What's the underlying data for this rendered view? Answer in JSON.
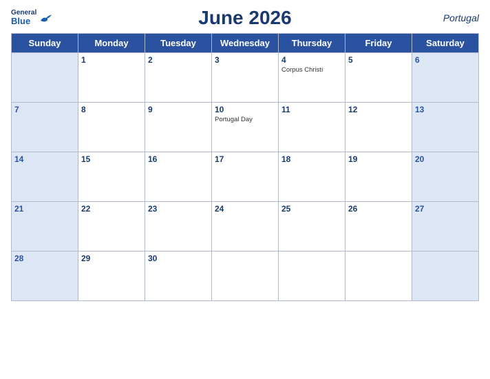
{
  "header": {
    "logo_general": "General",
    "logo_blue": "Blue",
    "title": "June 2026",
    "country": "Portugal"
  },
  "weekdays": [
    "Sunday",
    "Monday",
    "Tuesday",
    "Wednesday",
    "Thursday",
    "Friday",
    "Saturday"
  ],
  "weeks": [
    [
      {
        "day": "",
        "holiday": ""
      },
      {
        "day": "1",
        "holiday": ""
      },
      {
        "day": "2",
        "holiday": ""
      },
      {
        "day": "3",
        "holiday": ""
      },
      {
        "day": "4",
        "holiday": "Corpus Christi"
      },
      {
        "day": "5",
        "holiday": ""
      },
      {
        "day": "6",
        "holiday": ""
      }
    ],
    [
      {
        "day": "7",
        "holiday": ""
      },
      {
        "day": "8",
        "holiday": ""
      },
      {
        "day": "9",
        "holiday": ""
      },
      {
        "day": "10",
        "holiday": "Portugal Day"
      },
      {
        "day": "11",
        "holiday": ""
      },
      {
        "day": "12",
        "holiday": ""
      },
      {
        "day": "13",
        "holiday": ""
      }
    ],
    [
      {
        "day": "14",
        "holiday": ""
      },
      {
        "day": "15",
        "holiday": ""
      },
      {
        "day": "16",
        "holiday": ""
      },
      {
        "day": "17",
        "holiday": ""
      },
      {
        "day": "18",
        "holiday": ""
      },
      {
        "day": "19",
        "holiday": ""
      },
      {
        "day": "20",
        "holiday": ""
      }
    ],
    [
      {
        "day": "21",
        "holiday": ""
      },
      {
        "day": "22",
        "holiday": ""
      },
      {
        "day": "23",
        "holiday": ""
      },
      {
        "day": "24",
        "holiday": ""
      },
      {
        "day": "25",
        "holiday": ""
      },
      {
        "day": "26",
        "holiday": ""
      },
      {
        "day": "27",
        "holiday": ""
      }
    ],
    [
      {
        "day": "28",
        "holiday": ""
      },
      {
        "day": "29",
        "holiday": ""
      },
      {
        "day": "30",
        "holiday": ""
      },
      {
        "day": "",
        "holiday": ""
      },
      {
        "day": "",
        "holiday": ""
      },
      {
        "day": "",
        "holiday": ""
      },
      {
        "day": "",
        "holiday": ""
      }
    ]
  ]
}
